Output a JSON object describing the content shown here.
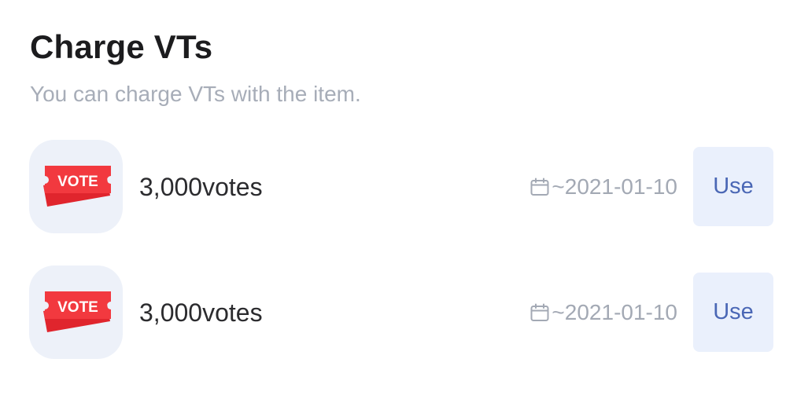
{
  "header": {
    "title": "Charge VTs",
    "subtitle": "You can charge VTs with the item."
  },
  "items": [
    {
      "icon": "vote-ticket-icon",
      "ticket_label": "VOTE",
      "name": "3,000votes",
      "expiry": "~2021-01-10",
      "action_label": "Use"
    },
    {
      "icon": "vote-ticket-icon",
      "ticket_label": "VOTE",
      "name": "3,000votes",
      "expiry": "~2021-01-10",
      "action_label": "Use"
    }
  ],
  "colors": {
    "ticket_red": "#f2393f",
    "ticket_dark_red": "#e0252d",
    "button_bg": "#eaf0fc",
    "button_text": "#4a67b5",
    "thumb_bg": "#edf1f9"
  }
}
